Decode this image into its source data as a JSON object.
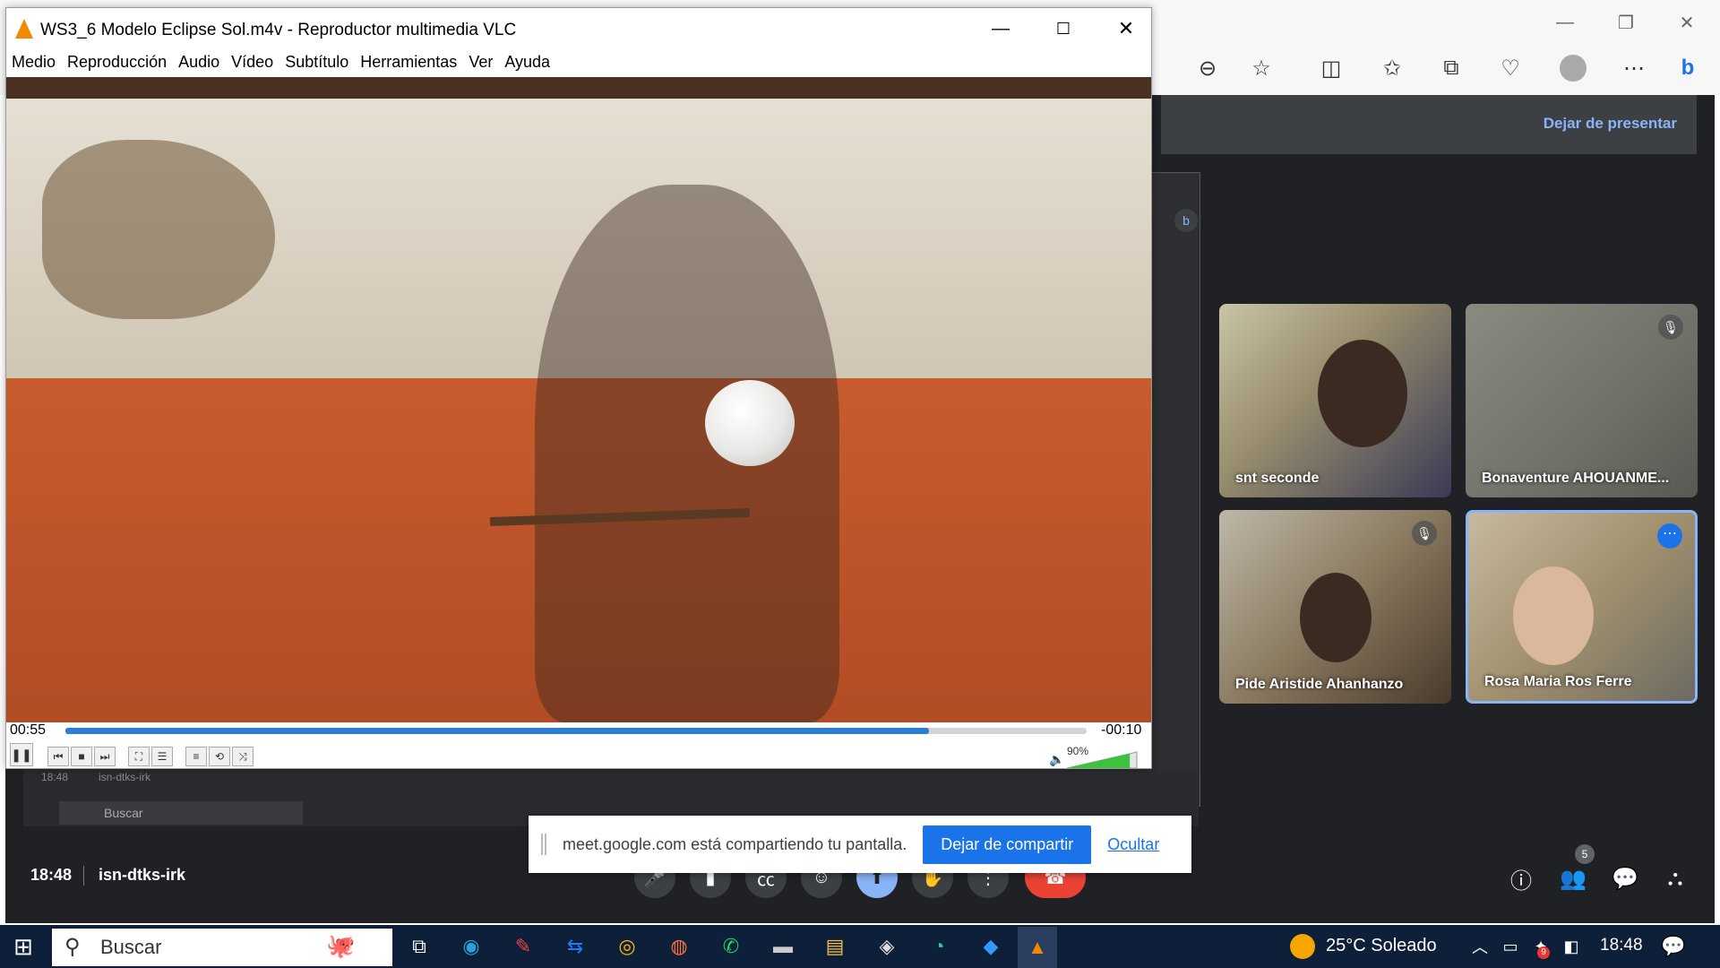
{
  "vlc": {
    "title": "WS3_6 Modelo Eclipse Sol.m4v - Reproductor multimedia VLC",
    "menu": [
      "Medio",
      "Reproducción",
      "Audio",
      "Vídeo",
      "Subtítulo",
      "Herramientas",
      "Ver",
      "Ayuda"
    ],
    "time_elapsed": "00:55",
    "time_remaining": "-00:10",
    "progress": 0.846,
    "volume_label": "90%",
    "volume": 0.9
  },
  "meet": {
    "stop_presenting": "Dejar de presentar",
    "participants": [
      {
        "name": "snt seconde",
        "muted": false
      },
      {
        "name": "Bonaventure AHOUANME...",
        "muted": true
      },
      {
        "name": "Pide Aristide Ahanhanzo",
        "muted": true
      },
      {
        "name": "Rosa Maria Ros Ferre",
        "muted": false
      }
    ],
    "time": "18:48",
    "code": "isn-dtks-irk",
    "people_count": "5",
    "mirror_time": "18:48",
    "mirror_code": "isn-dtks-irk",
    "mirror_search": "Buscar"
  },
  "share_bar": {
    "message": "meet.google.com está compartiendo tu pantalla.",
    "stop_label": "Dejar de compartir",
    "hide_label": "Ocultar"
  },
  "taskbar": {
    "search_placeholder": "Buscar",
    "weather": "25°C  Soleado",
    "clock": "18:48",
    "notification_badge": "9"
  },
  "colors": {
    "accent": "#1a73e8",
    "meet_bg": "#202124",
    "end_call": "#ea4335",
    "vlc_progress": "#2c7fd8"
  }
}
